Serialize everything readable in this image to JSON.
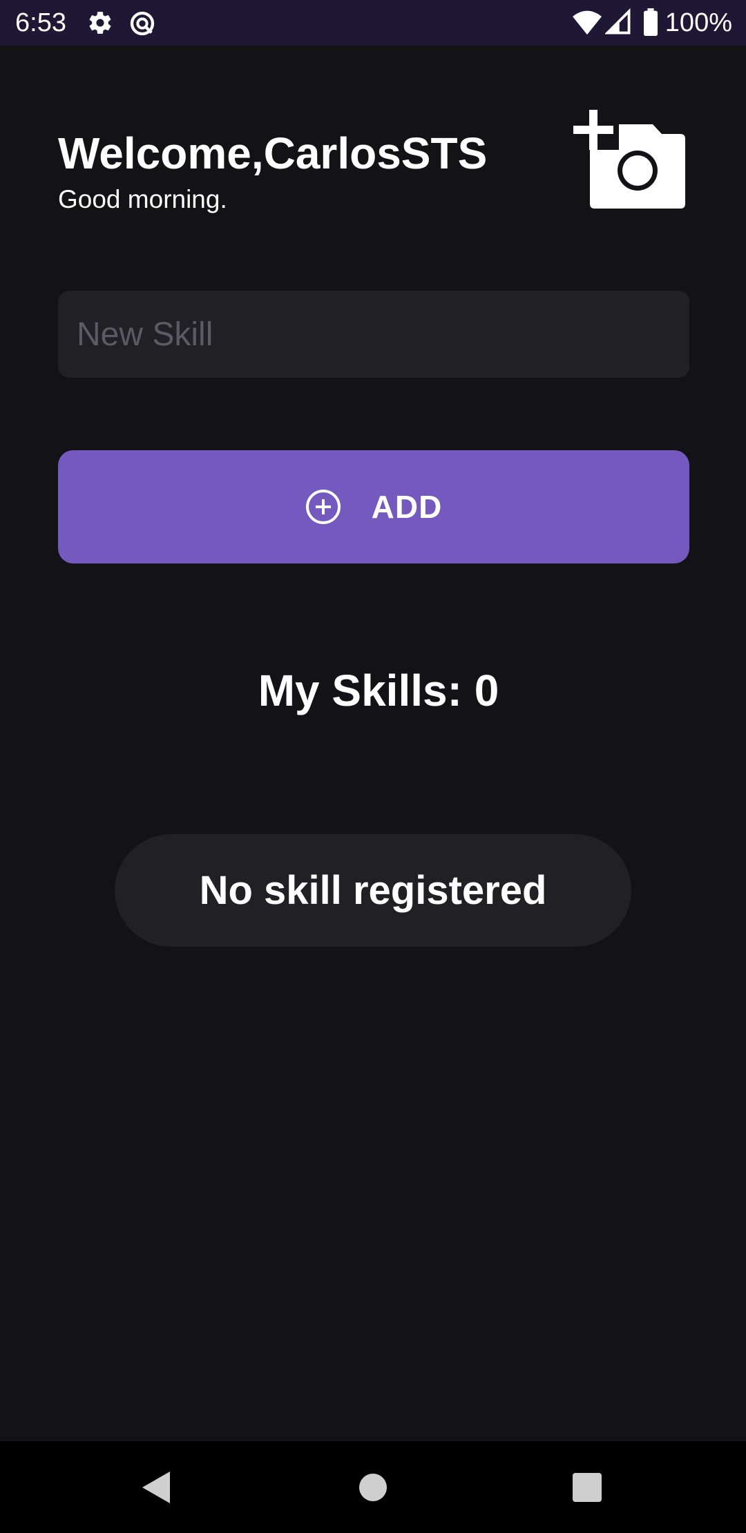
{
  "status_bar": {
    "time": "6:53",
    "battery": "100%",
    "icons": [
      "gear-icon",
      "data-saver-icon",
      "wifi-icon",
      "signal-icon",
      "battery-icon"
    ]
  },
  "header": {
    "title": "Welcome,CarlosSTS",
    "subtitle": "Good morning.",
    "photo_button_icon": "add-photo-camera-icon"
  },
  "skill_input": {
    "placeholder": "New Skill",
    "value": ""
  },
  "add_button": {
    "label": "ADD",
    "icon": "plus-circle-icon"
  },
  "skills": {
    "count_label": "My Skills: 0",
    "empty_message": "No skill registered"
  },
  "nav_bar": {
    "icons": [
      "back-icon",
      "home-icon",
      "recents-icon"
    ]
  },
  "colors": {
    "background": "#131217",
    "status_bar": "#1f1834",
    "surface": "#212025",
    "accent": "#7459bf",
    "text": "#ffffff",
    "placeholder": "#5c5b61"
  }
}
